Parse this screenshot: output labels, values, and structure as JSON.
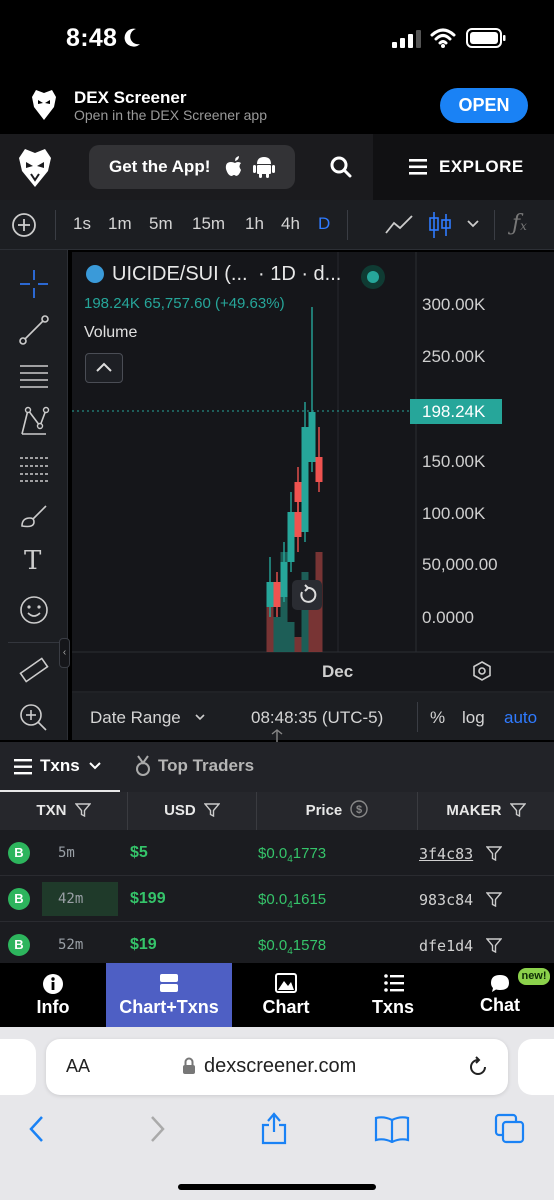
{
  "status_bar": {
    "time": "8:48"
  },
  "app_banner": {
    "title": "DEX Screener",
    "subtitle": "Open in the DEX Screener app",
    "open_label": "OPEN"
  },
  "nav": {
    "get_app_label": "Get the App!",
    "explore_label": "EXPLORE"
  },
  "toolbar": {
    "timeframes": [
      "1s",
      "1m",
      "5m",
      "15m",
      "1h",
      "4h",
      "D"
    ],
    "active_timeframe": "D"
  },
  "chart": {
    "symbol": "UICIDE/SUI (...",
    "interval": "· 1D · d...",
    "ohlc_line": "198.24K  65,757.60 (+49.63%)",
    "volume_label": "Volume",
    "price_axis": [
      "300.00K",
      "250.00K",
      "150.00K",
      "100.00K",
      "50,000.00",
      "0.0000"
    ],
    "last_price_label": "198.24K",
    "x_axis_label": "Dec",
    "accent_up": "#26a69a",
    "accent_down": "#ef5350"
  },
  "chart_footer": {
    "date_range_label": "Date Range",
    "clock": "08:48:35 (UTC-5)",
    "percent_label": "%",
    "log_label": "log",
    "auto_label": "auto"
  },
  "txns_header": {
    "txns_label": "Txns",
    "top_traders_label": "Top Traders"
  },
  "columns": {
    "txn": "TXN",
    "usd": "USD",
    "price": "Price",
    "maker": "MAKER"
  },
  "rows": [
    {
      "type": "B",
      "age": "5m",
      "usd": "$5",
      "price_prefix": "$0.0",
      "price_sub": "4",
      "price_rest": "1773",
      "maker": "3f4c83"
    },
    {
      "type": "B",
      "age": "42m",
      "usd": "$199",
      "price_prefix": "$0.0",
      "price_sub": "4",
      "price_rest": "1615",
      "maker": "983c84"
    },
    {
      "type": "B",
      "age": "52m",
      "usd": "$19",
      "price_prefix": "$0.0",
      "price_sub": "4",
      "price_rest": "1578",
      "maker": "dfe1d4"
    }
  ],
  "bottom_tabs": [
    {
      "label": "Info",
      "icon": "info-icon"
    },
    {
      "label": "Chart+Txns",
      "icon": "chart-txns-icon"
    },
    {
      "label": "Chart",
      "icon": "chart-icon"
    },
    {
      "label": "Txns",
      "icon": "list-icon"
    },
    {
      "label": "Chat",
      "icon": "chat-icon",
      "badge": "new!"
    }
  ],
  "safari": {
    "aa_label": "AA",
    "url": "dexscreener.com"
  }
}
